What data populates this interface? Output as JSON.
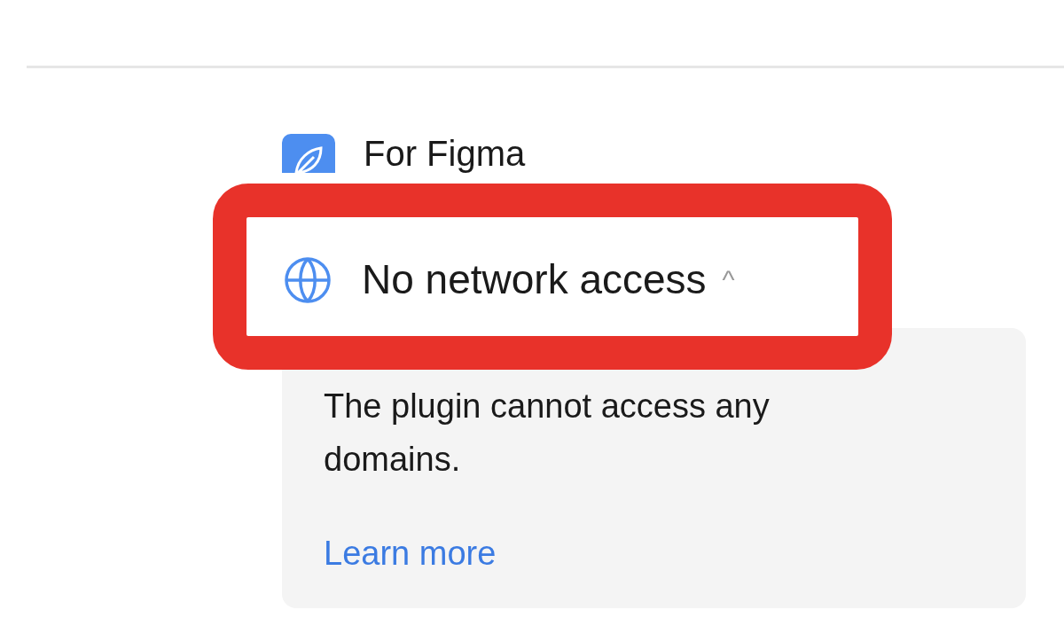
{
  "plugin": {
    "name": "For Figma"
  },
  "permission": {
    "label": "No network access",
    "expanded": true,
    "caret": "^",
    "description": "The plugin cannot access any domains.",
    "link": "Learn more"
  },
  "highlight": {
    "kind": "annotation"
  }
}
